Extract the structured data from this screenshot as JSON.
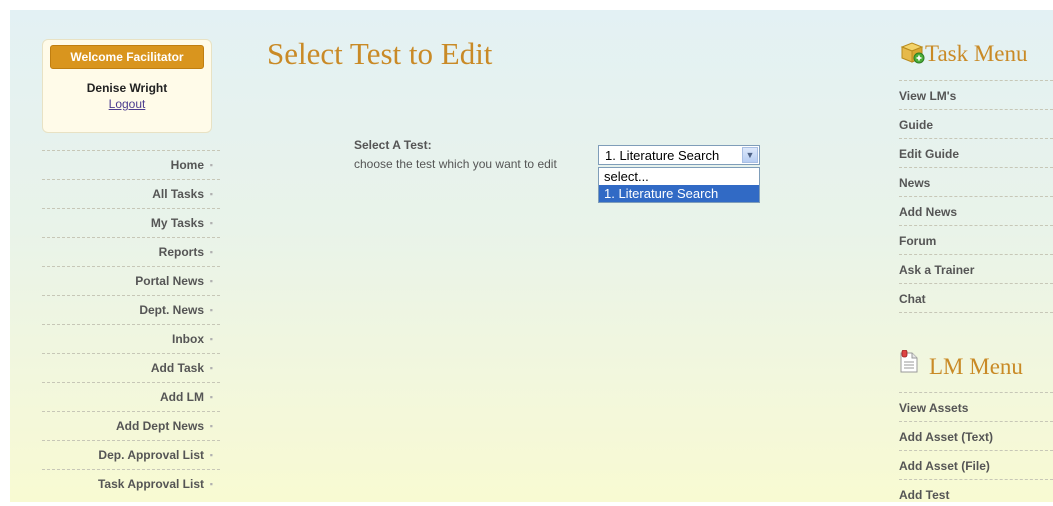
{
  "welcome": {
    "badge": "Welcome Facilitator",
    "user_name": "Denise Wright",
    "logout": "Logout"
  },
  "left_nav": [
    {
      "label": "Home"
    },
    {
      "label": "All Tasks"
    },
    {
      "label": "My Tasks"
    },
    {
      "label": "Reports"
    },
    {
      "label": "Portal News"
    },
    {
      "label": "Dept. News"
    },
    {
      "label": "Inbox"
    },
    {
      "label": "Add Task"
    },
    {
      "label": "Add LM"
    },
    {
      "label": "Add Dept News"
    },
    {
      "label": "Dep. Approval List"
    },
    {
      "label": "Task Approval List"
    }
  ],
  "main": {
    "title": "Select Test to Edit",
    "select_label": "Select A Test:",
    "select_hint": "choose the test which you want to edit",
    "select_value": "1. Literature Search",
    "options": [
      "select...",
      "1. Literature Search"
    ],
    "highlighted_option": "1. Literature Search"
  },
  "task_menu": {
    "title": "Task Menu",
    "icon": "package-add-icon",
    "items": [
      "View LM's",
      "Guide",
      "Edit Guide",
      "News",
      "Add News",
      "Forum",
      "Ask a Trainer",
      "Chat"
    ]
  },
  "lm_menu": {
    "title": "LM Menu",
    "icon": "document-icon",
    "items": [
      "View Assets",
      "Add Asset (Text)",
      "Add Asset (File)",
      "Add Test"
    ]
  },
  "colors": {
    "accent": "#c98a26",
    "badge": "#d9951e",
    "highlight": "#316ac5"
  }
}
